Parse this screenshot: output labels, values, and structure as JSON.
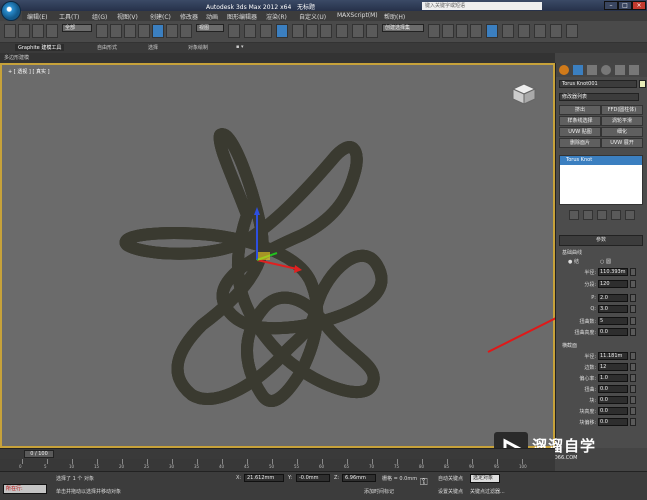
{
  "titlebar": {
    "app_title": "Autodesk 3ds Max  2012 x64",
    "doc_title": "无标题",
    "search_placeholder": "键入关键字或短语",
    "min_label": "–",
    "max_label": "□",
    "close_label": "×"
  },
  "menu": [
    "编辑(E)",
    "工具(T)",
    "组(G)",
    "视图(V)",
    "创建(C)",
    "修改器",
    "动画",
    "图形编辑器",
    "渲染(R)",
    "自定义(U)",
    "MAXScript(M)",
    "帮助(H)"
  ],
  "toolbar": {
    "selection_filter": "全部",
    "ref_coord": "视图",
    "named_sel_placeholder": "创建选择集"
  },
  "ribbon": {
    "tabs": [
      "Graphite 建模工具",
      "自由形式",
      "选择",
      "对象绘制"
    ],
    "sub_label": "多边形建模"
  },
  "viewport": {
    "label": "+ [ 透视 ] [ 真实 ]",
    "object_color": "#e4e6c7",
    "border_color": "#c7a23a"
  },
  "command_panel": {
    "object_name": "Torus Knot001",
    "object_color": "#e7ebb8",
    "modifier_list": "修改器列表",
    "modifier_buttons": [
      "挤出",
      "FFD(圆柱体)",
      "样条线选择",
      "涡轮平滑",
      "UVW 贴图",
      "细化",
      "删除面片",
      "UVW 展开"
    ],
    "stack_item": "Torus Knot",
    "params_rollout": "参数",
    "base_curve_label": "基础曲线",
    "knot_option": "结",
    "circle_option": "圆",
    "radius_label": "半径:",
    "radius_value": "110.393m",
    "segments_label": "分段:",
    "segments_value": "120",
    "p_label": "P:",
    "p_value": "2.0",
    "q_label": "Q:",
    "q_value": "3.0",
    "warp_count_label": "扭曲数:",
    "warp_count_value": "5",
    "warp_height_label": "扭曲高度:",
    "warp_height_value": "0.0",
    "cross_section_label": "横截面",
    "cs_radius_label": "半径:",
    "cs_radius_value": "11.181m",
    "sides_label": "边数:",
    "sides_value": "12",
    "eccentricity_label": "偏心率:",
    "eccentricity_value": "1.0",
    "twist_label": "扭曲:",
    "twist_value": "0.0",
    "lumps_label": "块:",
    "lumps_value": "0.0",
    "lump_height_label": "块高度:",
    "lump_height_value": "0.0",
    "lump_offset_label": "块偏移:",
    "lump_offset_value": "0.0"
  },
  "timeline": {
    "frame_counter": "0 / 100",
    "ticks": [
      "0",
      "5",
      "10",
      "15",
      "20",
      "25",
      "30",
      "35",
      "40",
      "45",
      "50",
      "55",
      "60",
      "65",
      "70",
      "75",
      "80",
      "85",
      "90",
      "95",
      "100"
    ]
  },
  "status": {
    "run_button": "所在行:",
    "selected_text": "选择了 1 个 对象",
    "prompt_text": "单击并拖动以选择并移动对象",
    "x_label": "X:",
    "x_value": "21.612mm",
    "y_label": "Y:",
    "y_value": "-0.0mm",
    "z_label": "Z:",
    "z_value": "6.96mm",
    "grid_label": "栅格 = 0.0mm",
    "auto_key": "自动关键点",
    "selected_dd": "选定对象",
    "set_key": "设置关键点",
    "key_filters": "关键点过滤器...",
    "add_time_tag": "添加时间标记"
  },
  "watermark": {
    "title": "溜溜自学",
    "url": "ZIXUE.3D66.COM"
  },
  "annotation": {
    "arrow_color": "#e01818"
  }
}
